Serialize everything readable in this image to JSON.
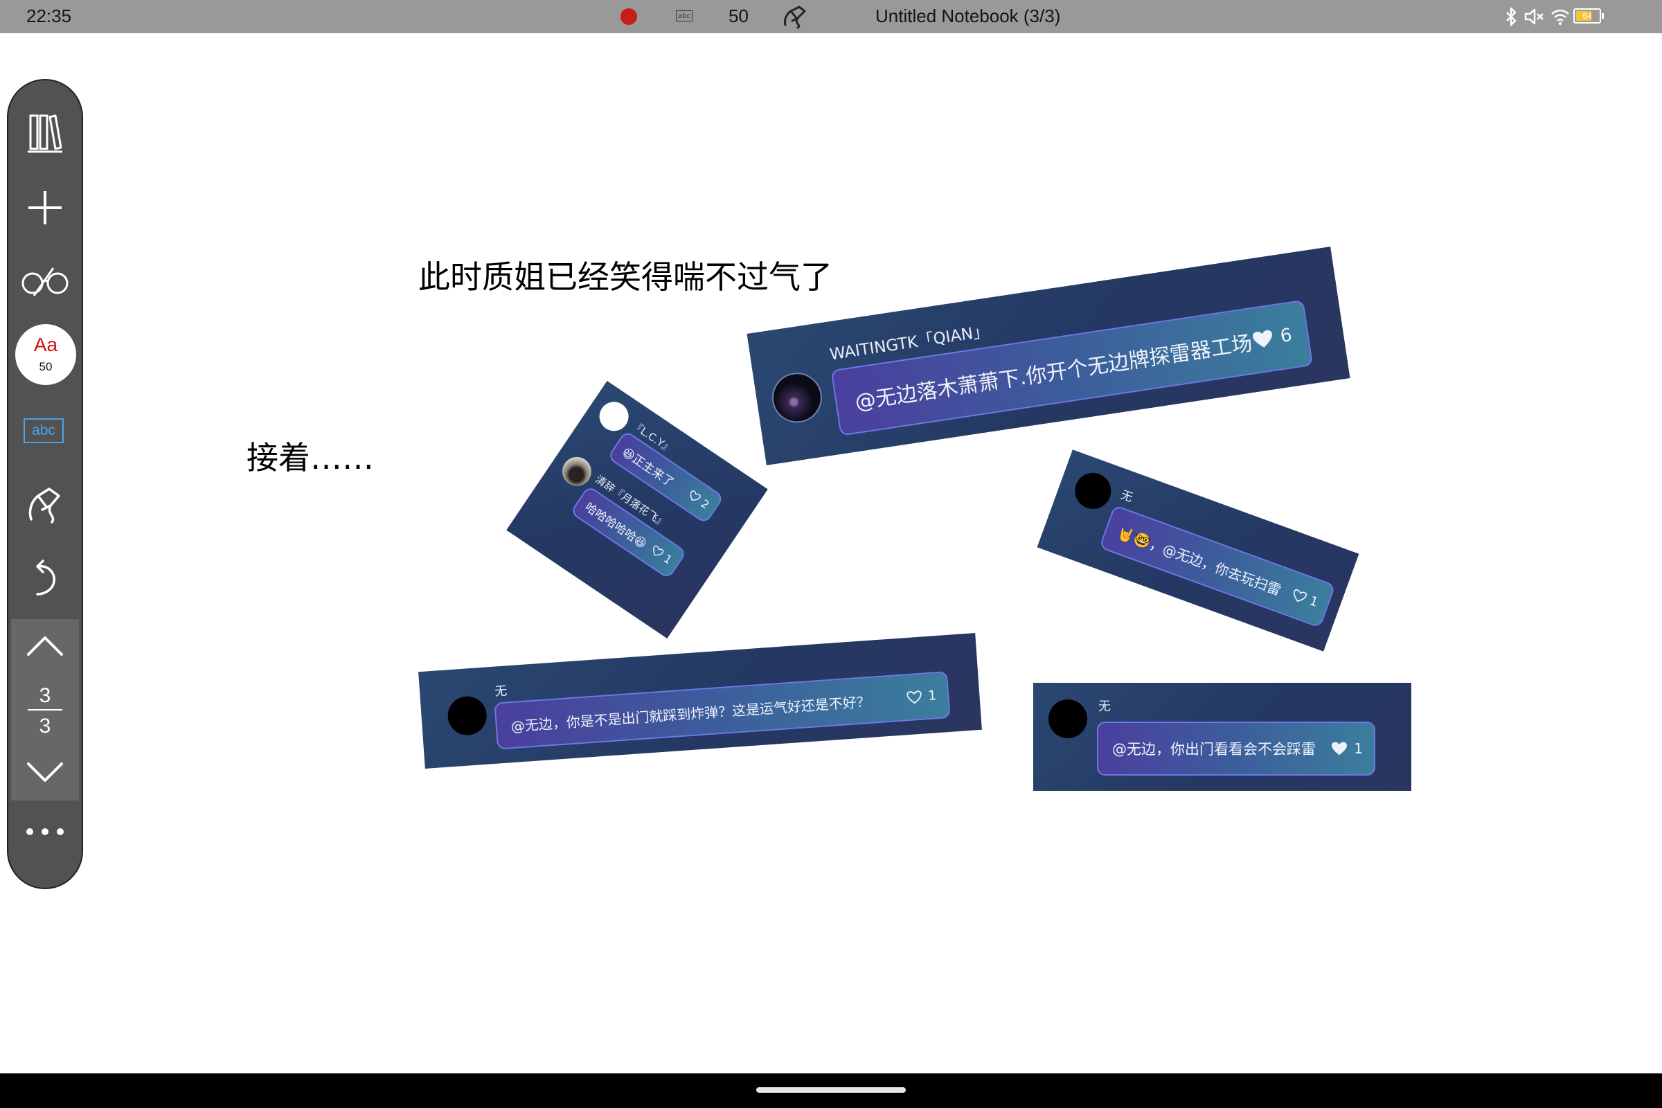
{
  "status_bar": {
    "time": "22:35",
    "pen_size": "50",
    "abc_label": "abc",
    "title": "Untitled Notebook (3/3)",
    "battery_level": "64",
    "icons": [
      "record-icon",
      "text-box-icon",
      "pen-icon",
      "bluetooth-icon",
      "mute-icon",
      "wifi-icon",
      "battery-icon"
    ]
  },
  "toolbar": {
    "items": [
      "library-icon",
      "add-icon",
      "read-mode-icon",
      "font-tool",
      "text-box-tool",
      "lasso-tool-icon",
      "undo-icon",
      "page-up-icon",
      "page-down-icon",
      "more-icon"
    ],
    "font_label": "Aa",
    "font_size": "50",
    "abc_label": "abc",
    "current_page": "3",
    "total_pages": "3",
    "accent_color": "#d40f0f",
    "text_tool_color": "#4ba3e6"
  },
  "page": {
    "text_line_1": "此时质姐已经笑得喘不过气了",
    "text_line_2": "接着……"
  },
  "comments": [
    {
      "user": "WAITINGTK「QIAN」",
      "text": "@无边落木萧萧下.你开个无边牌探雷器工场",
      "likes": "6",
      "liked": true
    },
    {
      "user": "『L.C.Y』",
      "text": "😆正主来了",
      "likes": "2",
      "reply_user": "清辞『月落花飞』",
      "reply_text": "哈哈哈哈哈😆",
      "reply_likes": "1"
    },
    {
      "user": "无",
      "text": "🤘🤓，@无边，你去玩扫雷",
      "likes": "1"
    },
    {
      "user": "无",
      "text": "@无边，你是不是出门就踩到炸弹？这是运气好还是不好？",
      "likes": "1"
    },
    {
      "user": "无",
      "text": "@无边，你出门看看会不会踩雷",
      "likes": "1",
      "liked": true
    }
  ]
}
